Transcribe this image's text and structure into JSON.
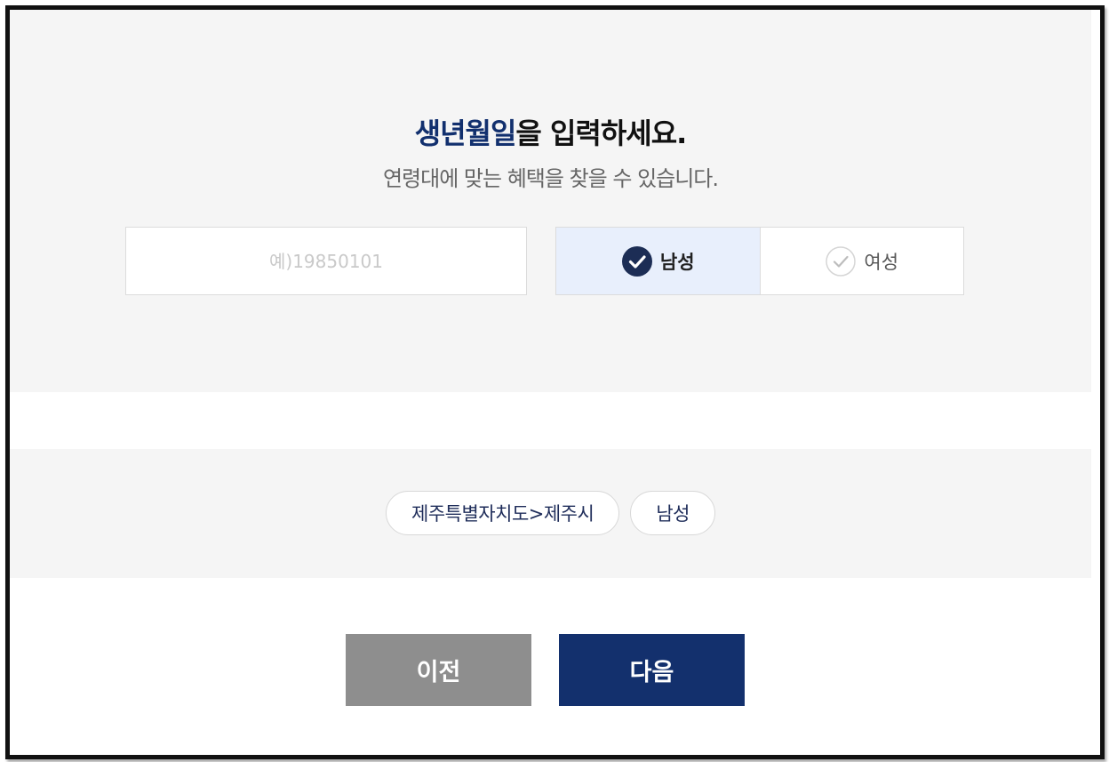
{
  "heading": {
    "accent": "생년월일",
    "rest": "을 입력하세요."
  },
  "subheading": "연령대에 맞는 혜택을 찾을 수 있습니다.",
  "birth_input": {
    "value": "",
    "placeholder": "예)19850101"
  },
  "gender": {
    "options": [
      {
        "label": "남성",
        "selected": true,
        "icon": "check-circle-filled-icon"
      },
      {
        "label": "여성",
        "selected": false,
        "icon": "check-circle-outline-icon"
      }
    ]
  },
  "selected_chips": [
    {
      "label": "제주특별자치도>제주시"
    },
    {
      "label": "남성"
    }
  ],
  "buttons": {
    "prev": "이전",
    "next": "다음"
  },
  "colors": {
    "accent": "#12306e",
    "selected_bg": "#e8effc",
    "prev_button": "#8e8e8e",
    "next_button": "#13306d"
  }
}
